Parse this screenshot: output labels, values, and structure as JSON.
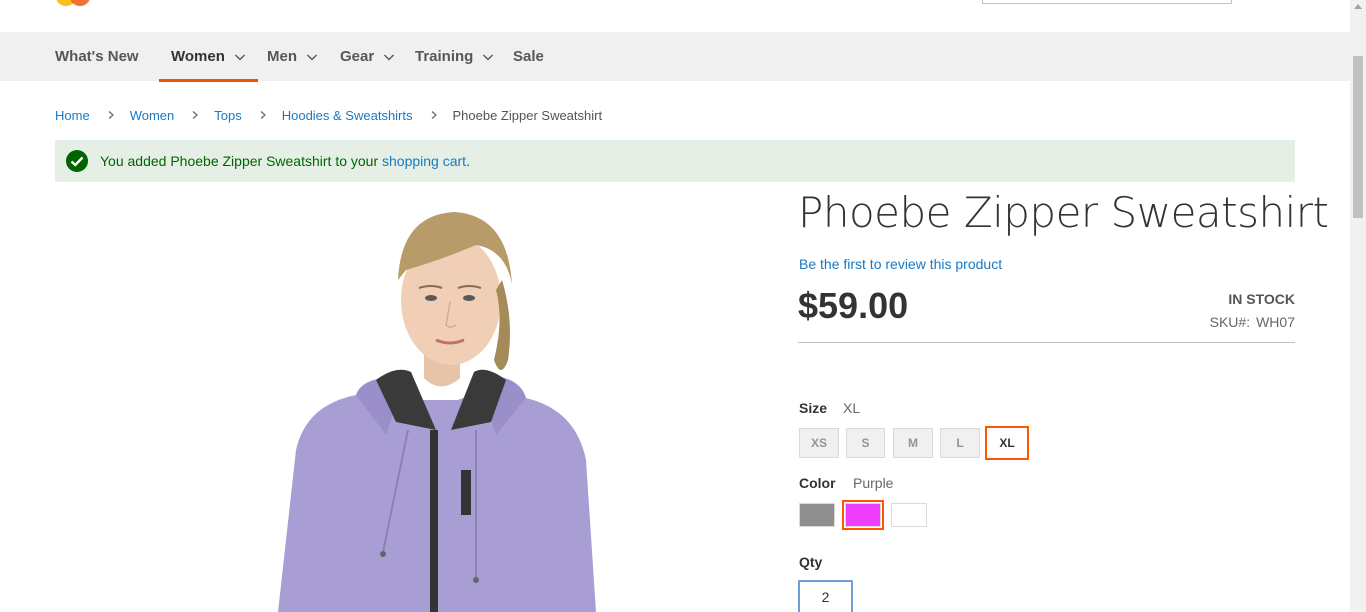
{
  "nav": {
    "items": [
      {
        "label": "What's New",
        "has_dropdown": false,
        "active": false
      },
      {
        "label": "Women",
        "has_dropdown": true,
        "active": true
      },
      {
        "label": "Men",
        "has_dropdown": true,
        "active": false
      },
      {
        "label": "Gear",
        "has_dropdown": true,
        "active": false
      },
      {
        "label": "Training",
        "has_dropdown": true,
        "active": false
      },
      {
        "label": "Sale",
        "has_dropdown": false,
        "active": false
      }
    ]
  },
  "breadcrumbs": [
    "Home",
    "Women",
    "Tops",
    "Hoodies & Sweatshirts",
    "Phoebe Zipper Sweatshirt"
  ],
  "message": {
    "prefix": "You added Phoebe Zipper Sweatshirt to your ",
    "link": "shopping cart",
    "suffix": "."
  },
  "product": {
    "title": "Phoebe Zipper Sweatshirt",
    "review_link": "Be the first to review this product",
    "price": "$59.00",
    "stock": "IN STOCK",
    "sku_label": "SKU#:",
    "sku": "WH07"
  },
  "size": {
    "label": "Size",
    "selected_value": "XL",
    "options": [
      "XS",
      "S",
      "M",
      "L",
      "XL"
    ]
  },
  "color": {
    "label": "Color",
    "selected_value": "Purple",
    "swatches": [
      {
        "name": "Gray",
        "hex": "#8f8f8f"
      },
      {
        "name": "Purple",
        "hex": "#ef3dff"
      },
      {
        "name": "White",
        "hex": "#ffffff"
      }
    ]
  },
  "qty": {
    "label": "Qty",
    "value": "2"
  },
  "colors": {
    "accent": "#eb5202",
    "link": "#1979c3",
    "success_bg": "#e5efe5",
    "success_text": "#006400"
  }
}
